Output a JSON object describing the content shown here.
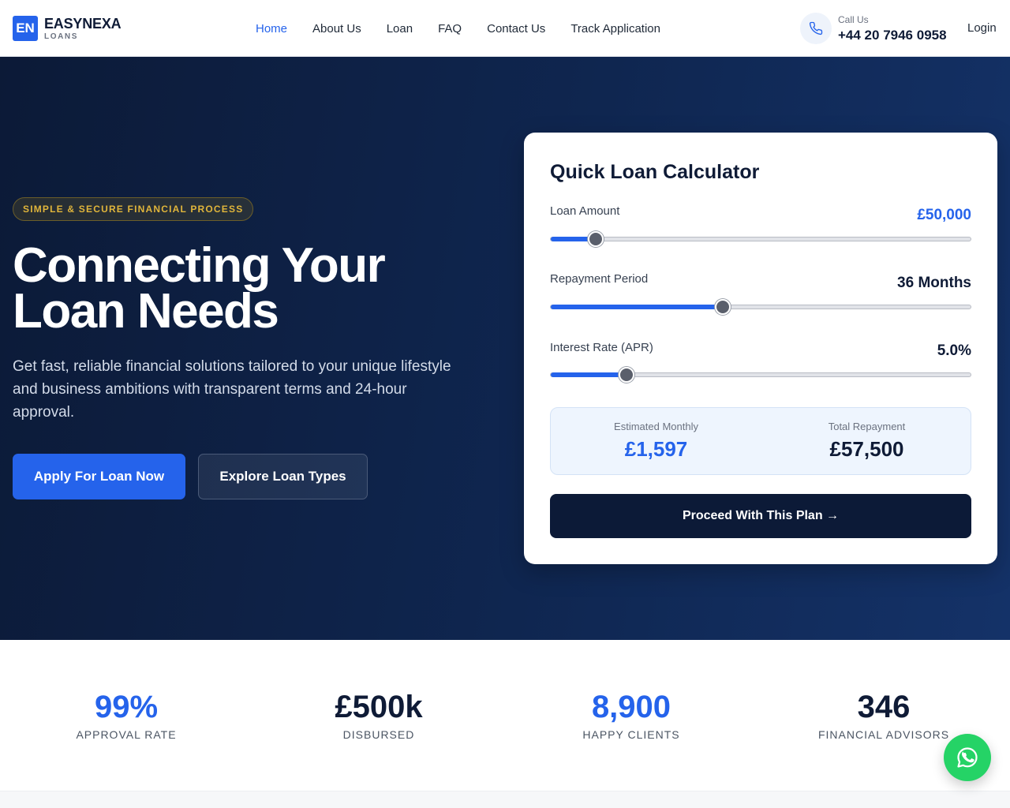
{
  "brand": {
    "logo": "EN",
    "name": "EASYNEXA",
    "sub": "LOANS"
  },
  "nav": {
    "links": [
      "Home",
      "About Us",
      "Loan",
      "FAQ",
      "Contact Us",
      "Track Application"
    ],
    "active": "Home",
    "call_label": "Call Us",
    "call_number": "+44 20 7946 0958",
    "login": "Login",
    "call_icon": "phone-icon"
  },
  "hero": {
    "badge": "SIMPLE & SECURE FINANCIAL PROCESS",
    "title_line1": "Connecting Your",
    "title_line2": "Loan Needs",
    "description": "Get fast, reliable financial solutions tailored to your unique lifestyle and business ambitions with transparent terms and 24-hour approval.",
    "primary_button": "Apply For Loan Now",
    "secondary_button": "Explore Loan Types"
  },
  "calculator": {
    "title": "Quick Loan Calculator",
    "amount_label": "Loan Amount",
    "amount_value": "£50,000",
    "amount_fraction": 0.107,
    "period_label": "Repayment Period",
    "period_value": "36 Months",
    "period_fraction": 0.41,
    "rate_label": "Interest Rate (APR)",
    "rate_value": "5.0%",
    "rate_fraction": 0.18,
    "monthly_label": "Estimated Monthly",
    "monthly_value": "£1,597",
    "total_label": "Total Repayment",
    "total_value": "£57,500",
    "proceed_button": "Proceed With This Plan →"
  },
  "stats": [
    {
      "value": "99%",
      "label": "APPROVAL RATE",
      "blue": true
    },
    {
      "value": "£500k",
      "label": "DISBURSED",
      "blue": false
    },
    {
      "value": "8,900",
      "label": "HAPPY CLIENTS",
      "blue": true
    },
    {
      "value": "346",
      "label": "FINANCIAL ADVISORS",
      "blue": false
    }
  ],
  "colors": {
    "accent": "#2563eb",
    "navy": "#0c1a37",
    "gold": "#e0b53b",
    "whatsapp": "#25d366"
  },
  "whatsapp_icon": "whatsapp-icon"
}
